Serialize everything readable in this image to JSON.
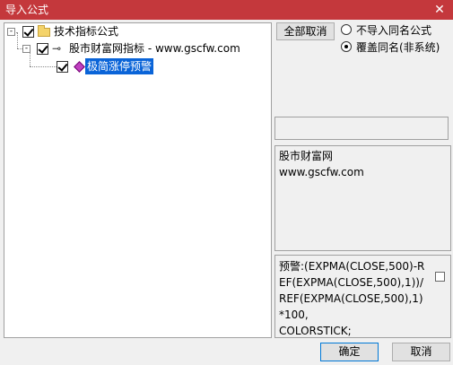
{
  "window": {
    "title": "导入公式",
    "close_glyph": "✕"
  },
  "tree": {
    "root": {
      "label": "技术指标公式",
      "toggle": "-"
    },
    "child": {
      "label": "股市财富网指标 - www.gscfw.com",
      "toggle": "-"
    },
    "leaf": {
      "label": "极简涨停预警"
    }
  },
  "options": {
    "deselect_all": "全部取消",
    "radio_skip": "不导入同名公式",
    "radio_overwrite": "覆盖同名(非系统)",
    "selected": "radio_overwrite"
  },
  "description": {
    "text": "股市财富网\nwww.gscfw.com"
  },
  "formula": {
    "text": "预警:(EXPMA(CLOSE,500)-REF(EXPMA(CLOSE,500),1))/REF(EXPMA(CLOSE,500),1)*100,\nCOLORSTICK;"
  },
  "footer": {
    "ok": "确定",
    "cancel": "取消"
  }
}
